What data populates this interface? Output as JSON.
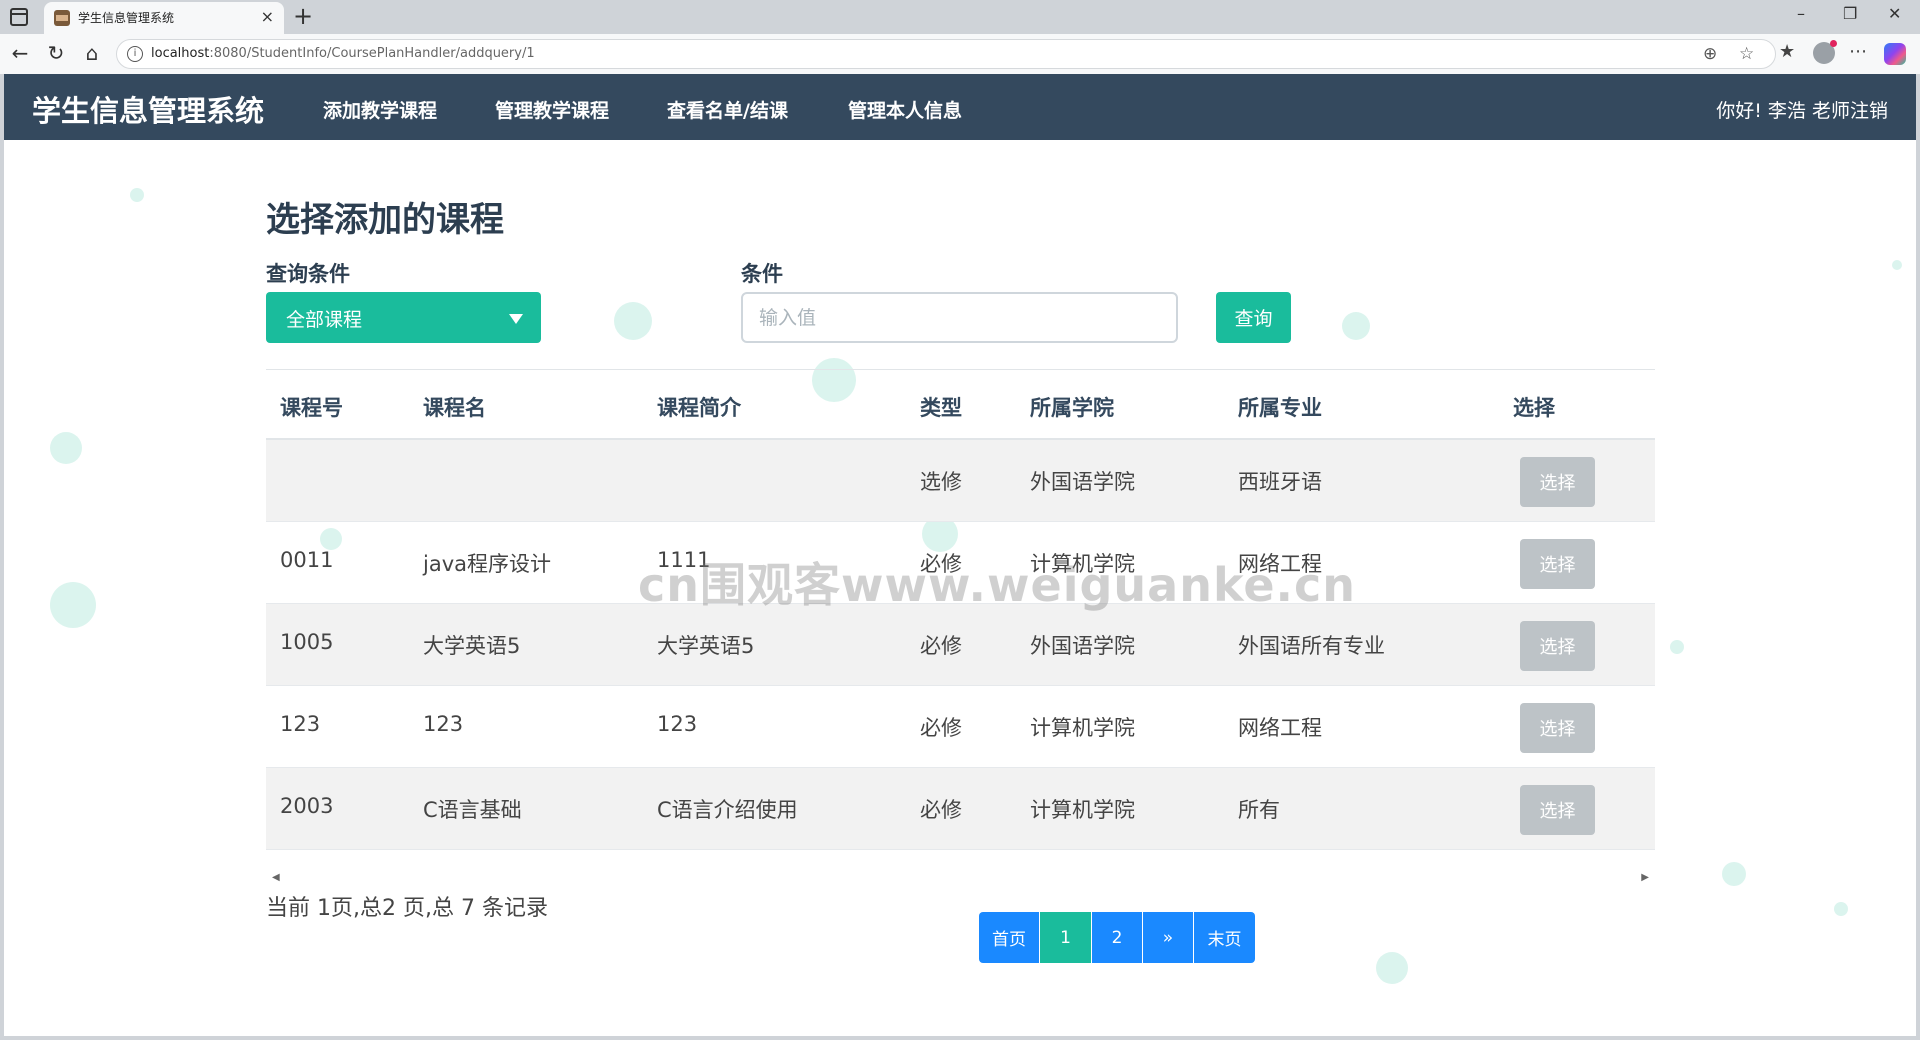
{
  "browser": {
    "tab_title": "学生信息管理系统",
    "tab_close": "×",
    "new_tab": "+",
    "url_prefix": "localhost",
    "url_rest": ":8080/StudentInfo/CoursePlanHandler/addquery/1",
    "win_min": "–",
    "win_max": "❐",
    "win_close": "✕"
  },
  "navbar": {
    "brand": "学生信息管理系统",
    "links": [
      "添加教学课程",
      "管理教学课程",
      "查看名单/结课",
      "管理本人信息"
    ],
    "greeting": "你好!",
    "user_name": "李浩",
    "logout": "老师注销"
  },
  "page": {
    "title": "选择添加的课程",
    "query_label": "查询条件",
    "condition_label": "条件",
    "select_value": "全部课程",
    "input_placeholder": "输入值",
    "input_value": "",
    "query_button": "查询"
  },
  "table": {
    "headers": [
      "课程号",
      "课程名",
      "课程简介",
      "类型",
      "所属学院",
      "所属专业",
      "选择"
    ],
    "rows": [
      {
        "id": "",
        "name": "",
        "intro": "",
        "type": "选修",
        "college": "外国语学院",
        "major": "西班牙语",
        "action": "选择"
      },
      {
        "id": "0011",
        "name": "java程序设计",
        "intro": "1111",
        "type": "必修",
        "college": "计算机学院",
        "major": "网络工程",
        "action": "选择"
      },
      {
        "id": "1005",
        "name": "大学英语5",
        "intro": "大学英语5",
        "type": "必修",
        "college": "外国语学院",
        "major": "外国语所有专业",
        "action": "选择"
      },
      {
        "id": "123",
        "name": "123",
        "intro": "123",
        "type": "必修",
        "college": "计算机学院",
        "major": "网络工程",
        "action": "选择"
      },
      {
        "id": "2003",
        "name": "C语言基础",
        "intro": "C语言介绍使用",
        "type": "必修",
        "college": "计算机学院",
        "major": "所有",
        "action": "选择"
      }
    ]
  },
  "pagination": {
    "summary": "当前 1页,总2 页,总 7 条记录",
    "first": "首页",
    "pages": [
      "1",
      "2"
    ],
    "active_page": "1",
    "next": "»",
    "last": "末页"
  },
  "watermark": "cn围观客www.weiguanke.cn",
  "colors": {
    "navbar": "#34495e",
    "accent": "#1abc9c",
    "pager": "#1a89ff",
    "disabled_button": "#bdc3c7"
  }
}
